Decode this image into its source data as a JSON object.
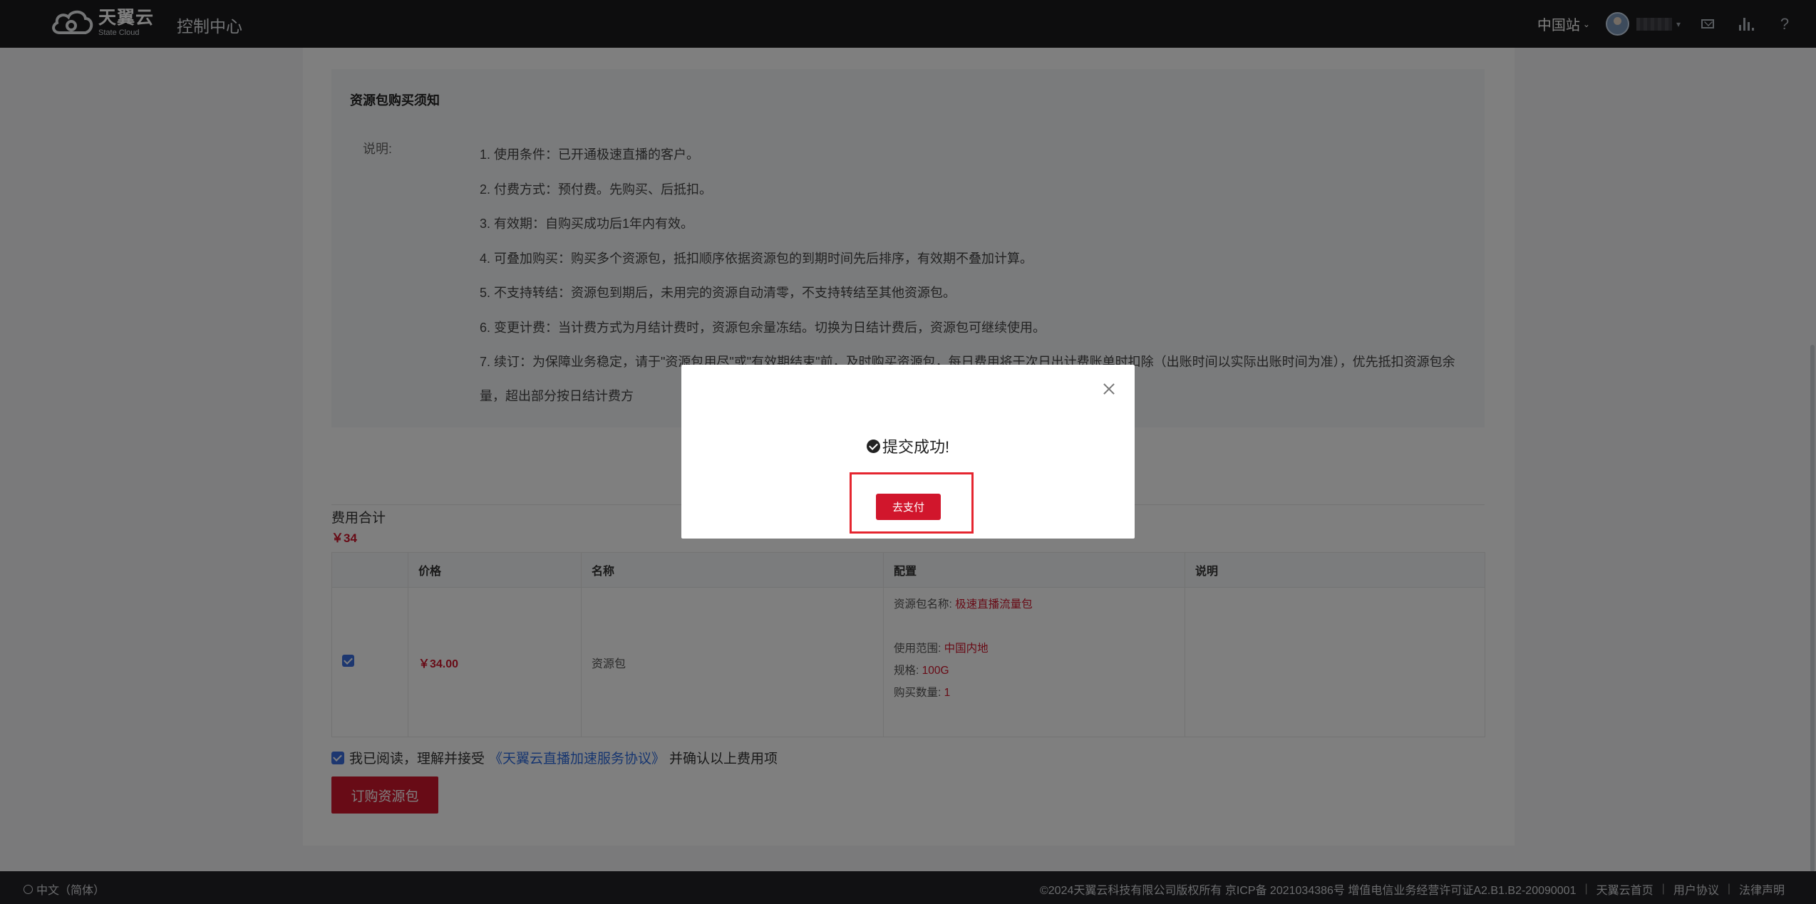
{
  "topbar": {
    "logo_cn": "天翼云",
    "logo_en": "State Cloud",
    "console_title": "控制中心",
    "region": "中国站",
    "icons": [
      "mail-icon",
      "chart-icon",
      "help-icon"
    ],
    "help_glyph": "?"
  },
  "notice": {
    "title": "资源包购买须知",
    "label": "说明:",
    "items": [
      "1. 使用条件：已开通极速直播的客户。",
      "2. 付费方式：预付费。先购买、后抵扣。",
      "3. 有效期：自购买成功后1年内有效。",
      "4. 可叠加购买：购买多个资源包，抵扣顺序依据资源包的到期时间先后排序，有效期不叠加计算。",
      "5. 不支持转结：资源包到期后，未用完的资源自动清零，不支持转结至其他资源包。",
      "6. 变更计费：当计费方式为月结计费时，资源包余量冻结。切换为日结计费后，资源包可继续使用。",
      "7. 续订：为保障业务稳定，请于\"资源包用尽\"或\"有效期结束\"前，及时购买资源包，每日费用将于次日出计费账单时扣除（出账时间以实际出账时间为准），优先抵扣资源包余量，超出部分按日结计费方"
    ]
  },
  "fee": {
    "title": "费用合计",
    "total": "￥34"
  },
  "table": {
    "headers": [
      "",
      "价格",
      "名称",
      "配置",
      "说明"
    ],
    "row": {
      "price": "￥34.00",
      "name": "资源包",
      "config": {
        "package_name_label": "资源包名称:",
        "package_name_value": "极速直播流量包",
        "scope_label": "使用范围:",
        "scope_value": "中国内地",
        "spec_label": "规格:",
        "spec_value": "100G",
        "qty_label": "购买数量:",
        "qty_value": "1"
      },
      "note": ""
    }
  },
  "agreement": {
    "prefix": "我已阅读，理解并接受",
    "link": "《天翼云直播加速服务协议》",
    "suffix": "并确认以上费用项"
  },
  "order_button": "订购资源包",
  "footer": {
    "language": "中文（简体）",
    "copyright": "©2024天翼云科技有限公司版权所有 京ICP备 2021034386号 增值电信业务经营许可证A2.B1.B2-20090001",
    "links": [
      "天翼云首页",
      "用户协议",
      "法律声明"
    ],
    "separator": "|"
  },
  "modal": {
    "message": "提交成功!",
    "pay_button": "去支付"
  },
  "colors": {
    "accent": "#d1162c",
    "link": "#2f6de1",
    "topbar": "#1b1b1d"
  }
}
